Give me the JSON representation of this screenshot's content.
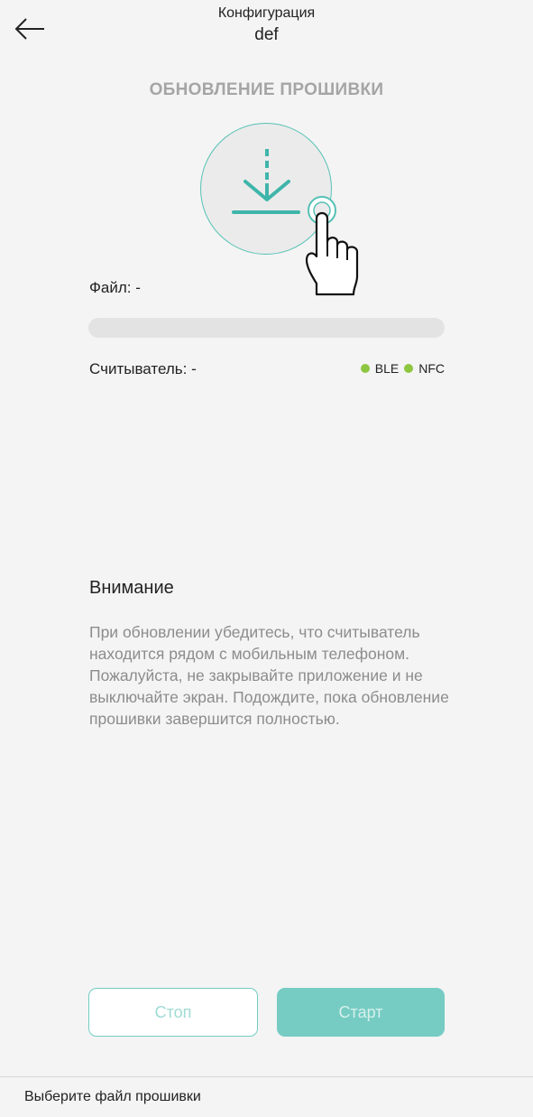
{
  "header": {
    "title": "Конфигурация",
    "subtitle": "def"
  },
  "section_title": "ОБНОВЛЕНИЕ ПРОШИВКИ",
  "file": {
    "label": "Файл: -"
  },
  "progress": {
    "percent": 0
  },
  "reader": {
    "label": "Считыватель: -"
  },
  "connections": [
    {
      "name": "BLE",
      "color": "#8dc63f"
    },
    {
      "name": "NFC",
      "color": "#8dc63f"
    }
  ],
  "warning": {
    "title": "Внимание",
    "text": "При обновлении убедитесь, что считыватель находится рядом с мобильным телефоном. Пожалуйста, не закрывайте приложение и не выключайте экран. Подождите, пока обновление прошивки завершится полностью."
  },
  "buttons": {
    "stop_label": "Стоп",
    "start_label": "Старт"
  },
  "footer": {
    "status_text": "Выберите файл прошивки"
  },
  "colors": {
    "accent": "#56c1b5",
    "button_fill": "#76ccc3",
    "status_dot": "#8dc63f"
  },
  "icons": {
    "back": "arrow-left-icon",
    "upload": "download-icon",
    "hand": "hand-pointer-icon"
  }
}
